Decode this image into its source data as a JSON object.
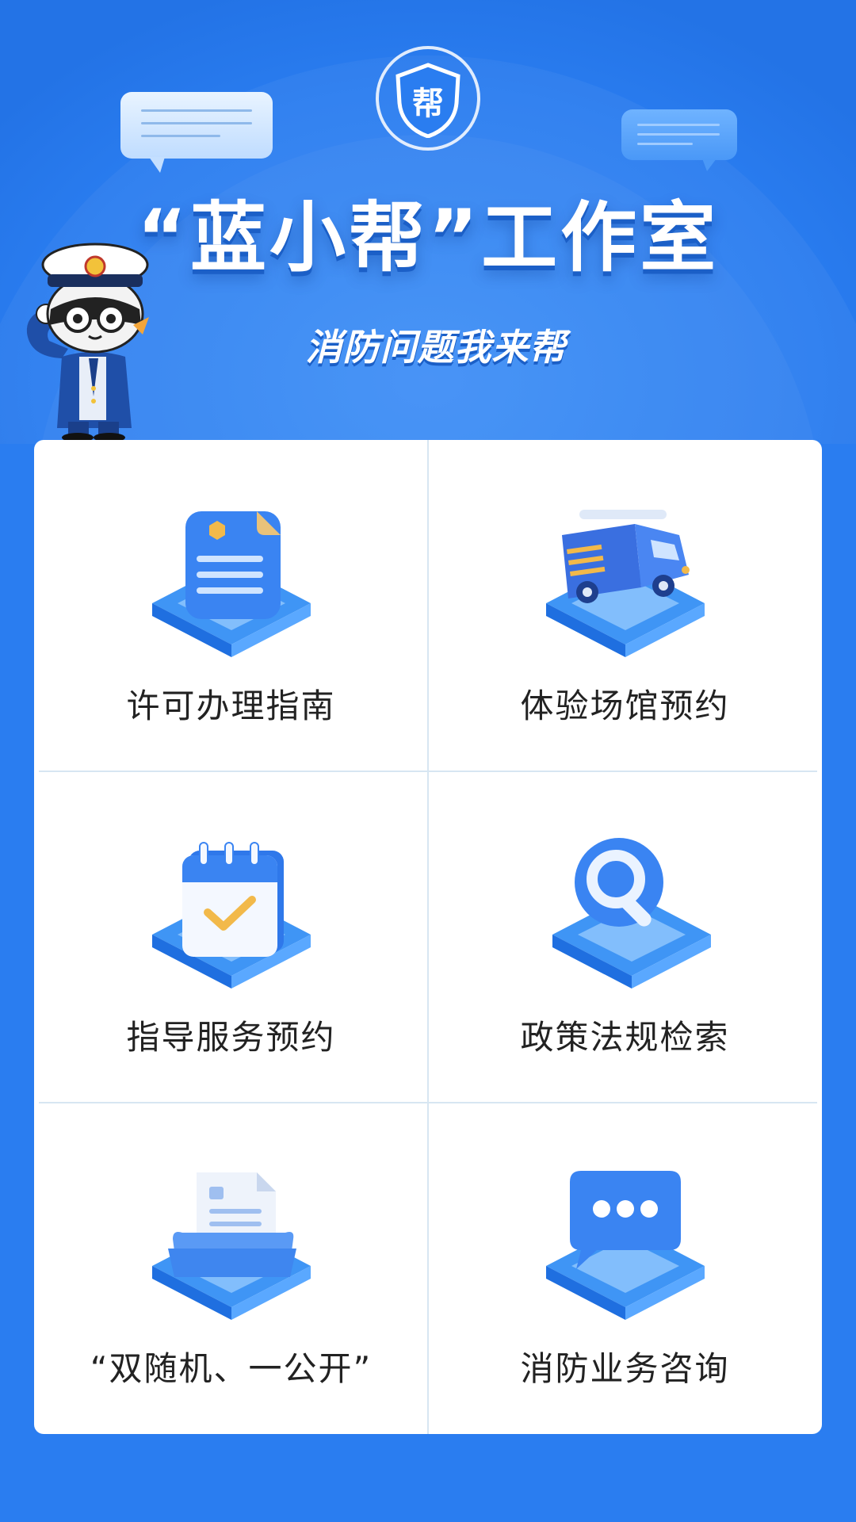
{
  "header": {
    "badge_char": "帮",
    "title": "“蓝小帮”工作室",
    "subtitle": "消防问题我来帮"
  },
  "menu": [
    {
      "label": "许可办理指南",
      "icon": "permit-document-icon"
    },
    {
      "label": "体验场馆预约",
      "icon": "fire-truck-icon"
    },
    {
      "label": "指导服务预约",
      "icon": "calendar-check-icon"
    },
    {
      "label": "政策法规检索",
      "icon": "magnifier-icon"
    },
    {
      "label": "“双随机、一公开”",
      "icon": "document-tray-icon"
    },
    {
      "label": "消防业务咨询",
      "icon": "chat-bubble-icon"
    }
  ],
  "colors": {
    "background": "#2a7df0",
    "card": "#ffffff",
    "divider": "#d7e6f2",
    "label": "#222222"
  }
}
